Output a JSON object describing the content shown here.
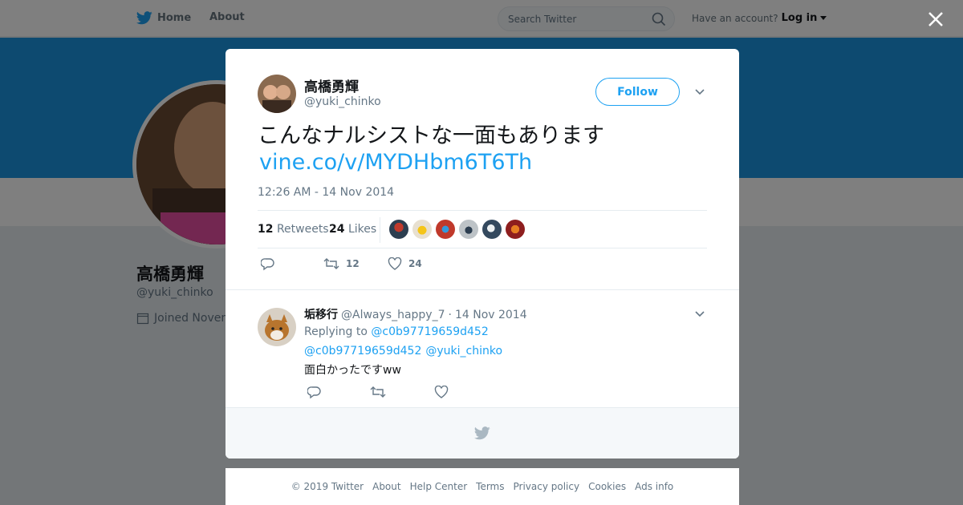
{
  "nav": {
    "home_label": "Home",
    "about_label": "About",
    "search_placeholder": "Search Twitter",
    "account_prompt": "Have an account?",
    "login_label": "Log in"
  },
  "profile": {
    "name": "高橋勇輝",
    "handle": "@yuki_chinko",
    "joined": "Joined Novem"
  },
  "tweet": {
    "author_name": "高橋勇輝",
    "author_handle": "@yuki_chinko",
    "follow_label": "Follow",
    "text": "こんなナルシストな一面もあります",
    "link": "vine.co/v/MYDHbm6T6Th",
    "timestamp": "12:26 AM - 14 Nov 2014",
    "retweets_count": "12",
    "retweets_label": "Retweets",
    "likes_count": "24",
    "likes_label": "Likes",
    "action_retweet_count": "12",
    "action_like_count": "24"
  },
  "reply": {
    "author_name": "垢移行",
    "author_handle": "@Always_happy_7",
    "separator": "·",
    "date": "14 Nov 2014",
    "replying_prefix": "Replying to",
    "replying_to": "@c0b97719659d452",
    "mentions": [
      "@c0b97719659d452",
      "@yuki_chinko"
    ],
    "text": "面白かったですww"
  },
  "footer": {
    "links": [
      "© 2019 Twitter",
      "About",
      "Help Center",
      "Terms",
      "Privacy policy",
      "Cookies",
      "Ads info"
    ]
  },
  "colors": {
    "brand_blue": "#1da1f2",
    "banner_blue": "#1b95e0",
    "text_primary": "#14171a",
    "text_secondary": "#657786"
  }
}
